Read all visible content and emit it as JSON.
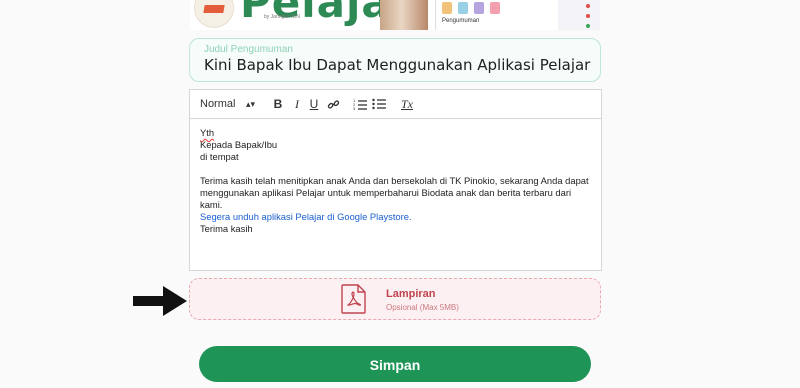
{
  "banner": {
    "brand": "Pelajar",
    "brand_sub": "by Jaringan IDN",
    "screen_title": "Pengumuman"
  },
  "title_field": {
    "label": "Judul Pengumuman",
    "value": "Kini Bapak Ibu Dapat Menggunakan Aplikasi Pelajar"
  },
  "toolbar": {
    "format_select": "Normal",
    "bold": "B",
    "italic": "I",
    "underline": "U",
    "clear": "Tx"
  },
  "body": {
    "line1": "Yth",
    "line2": "Kepada Bapak/Ibu",
    "line3": "di tempat",
    "line4": "Terima kasih telah menitipkan anak Anda dan bersekolah di TK Pinokio, sekarang Anda dapat",
    "line5": "menggunakan aplikasi Pelajar untuk memperbaharui Biodata anak dan berita terbaru dari kami.",
    "line6": "Segera unduh aplikasi Pelajar di Google Playstore.",
    "line7": "Terima kasih"
  },
  "attachment": {
    "title": "Lampiran",
    "subtitle": "Opsional (Max 5MB)"
  },
  "save_label": "Simpan",
  "colors": {
    "primary": "#1f9457",
    "attachment_accent": "#c0444f"
  }
}
